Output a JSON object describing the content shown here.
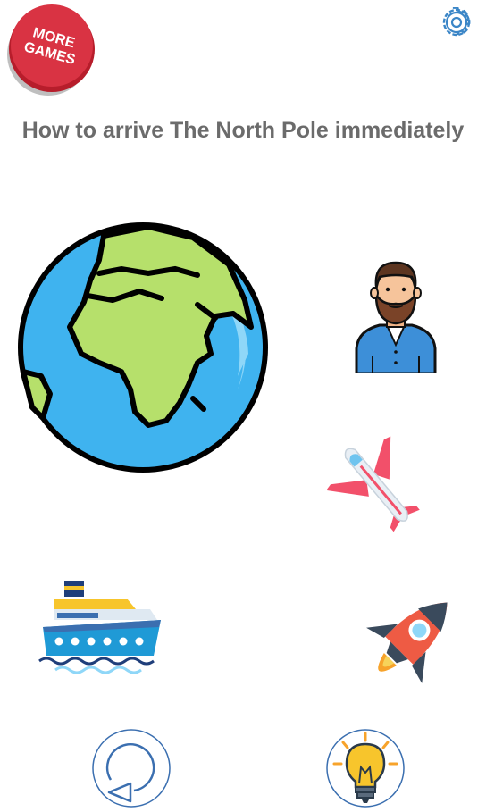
{
  "header": {
    "more_games_line1": "MORE",
    "more_games_line2": "GAMES",
    "settings_icon": "gear-icon"
  },
  "question": {
    "title": "How to arrive The North Pole immediately"
  },
  "items": [
    {
      "name": "globe",
      "icon": "earth-icon"
    },
    {
      "name": "man",
      "icon": "bearded-man-icon"
    },
    {
      "name": "airplane",
      "icon": "airplane-icon"
    },
    {
      "name": "ship",
      "icon": "cruise-ship-icon"
    },
    {
      "name": "rocket",
      "icon": "rocket-icon"
    }
  ],
  "footer": {
    "undo_icon": "undo-icon",
    "hint_icon": "lightbulb-icon"
  },
  "colors": {
    "title": "#6b6b6b",
    "more_games_red": "#d42e3c",
    "settings_blue": "#3b86c7",
    "ocean": "#3fb3ef",
    "land": "#b6e06b",
    "button_border": "#3b6fb0",
    "bulb": "#f7c52c"
  }
}
